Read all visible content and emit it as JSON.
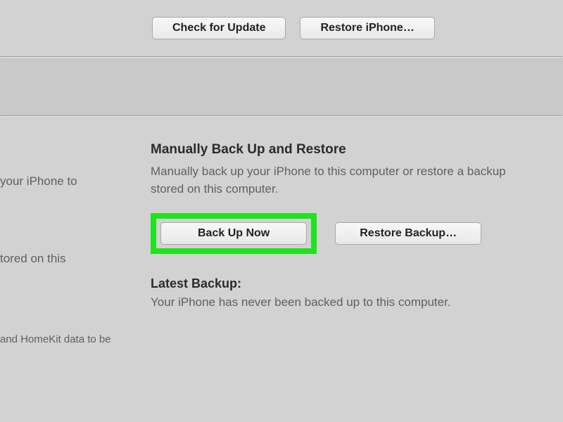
{
  "top": {
    "check_update_label": "Check for Update",
    "restore_iphone_label": "Restore iPhone…"
  },
  "left_fragments": {
    "line1": "your iPhone to",
    "line2": "tored on this",
    "line3": "and HomeKit data to be"
  },
  "backup_section": {
    "title": "Manually Back Up and Restore",
    "description": "Manually back up your iPhone to this computer or restore a backup stored on this computer.",
    "backup_now_label": "Back Up Now",
    "restore_backup_label": "Restore Backup…",
    "latest_label": "Latest Backup:",
    "latest_text": "Your iPhone has never been backed up to this computer."
  }
}
